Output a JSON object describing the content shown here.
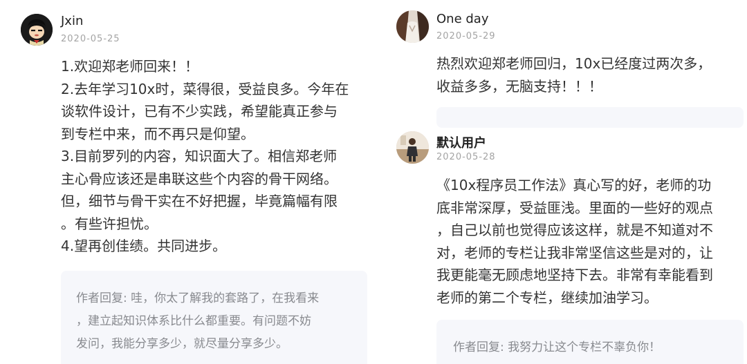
{
  "colors": {
    "name": "#222222",
    "date": "#a3a3a3",
    "content": "#333333",
    "reply_bg": "#f6f7fb",
    "reply_text": "#888a8f"
  },
  "comments": [
    {
      "user": "Jxin",
      "date": "2020-05-25",
      "avatar_icon": "cartoon-boy-avatar-icon",
      "lines": [
        "1.欢迎郑老师回来！！",
        "2.去年学习10x时，菜得很，受益良多。今年在",
        "谈软件设计，已有不少实践，希望能真正参与",
        "到专栏中来，而不再只是仰望。",
        "3.目前罗列的内容，知识面大了。相信郑老师",
        "主心骨应该还是串联这些个内容的骨干网络。",
        "但，细节与骨干实在不好把握，毕竟篇幅有限",
        "。有些许担忧。",
        "4.望再创佳绩。共同进步。"
      ],
      "reply_lines": [
        "作者回复: 哇，你太了解我的套路了，在我看来",
        "，建立起知识体系比什么都重要。有问题不妨",
        "发问，我能分享多少，就尽量分享多少。"
      ]
    },
    {
      "user": "One day",
      "date": "2020-05-29",
      "avatar_icon": "photo-avatar-icon",
      "lines": [
        "热烈欢迎郑老师回归，10x已经度过两次多，",
        "收益多多，无脑支持！！！"
      ]
    },
    {
      "user": "默认用户",
      "date": "2020-05-28",
      "avatar_icon": "photo-avatar-icon",
      "lines": [
        "《10x程序员工作法》真心写的好，老师的功",
        "底非常深厚，受益匪浅。里面的一些好的观点",
        "，自己以前也觉得应该这样，就是不知道对不",
        "对，老师的专栏让我非常坚信这些是对的，让",
        "我更能毫无顾虑地坚持下去。非常有幸能看到",
        "老师的第二个专栏，继续加油学习。"
      ],
      "reply_lines": [
        "作者回复: 我努力让这个专栏不辜负你！"
      ]
    }
  ]
}
